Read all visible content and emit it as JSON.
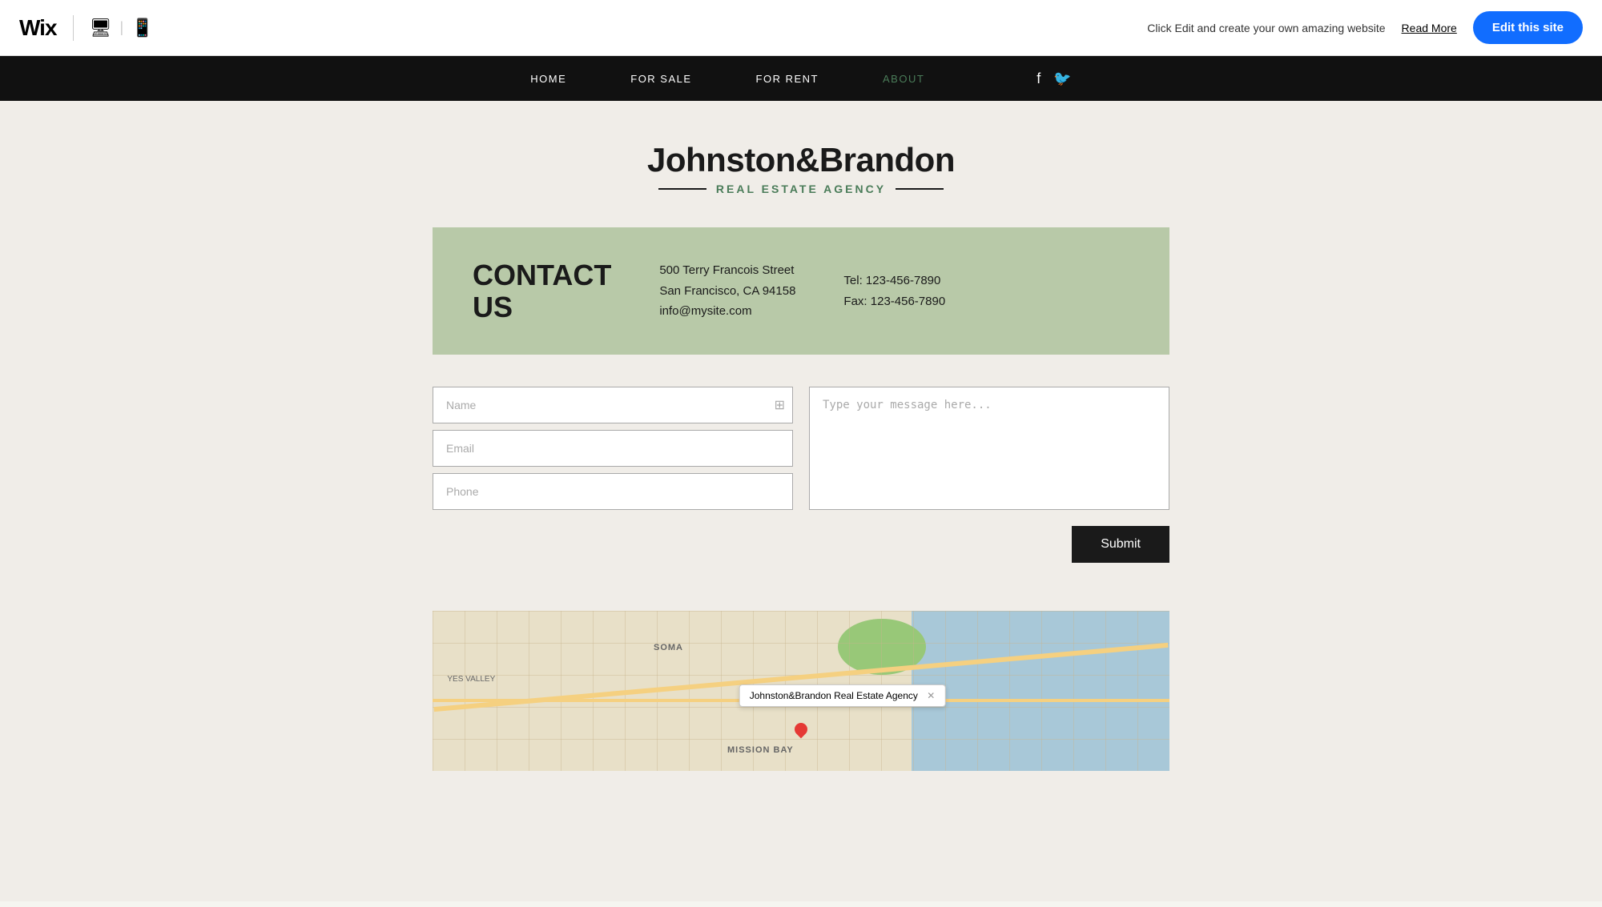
{
  "topbar": {
    "logo": "Wix",
    "message": "Click Edit and create your own amazing website",
    "read_more": "Read More",
    "edit_btn": "Edit this site"
  },
  "nav": {
    "items": [
      {
        "label": "HOME",
        "active": false
      },
      {
        "label": "FOR SALE",
        "active": false
      },
      {
        "label": "FOR RENT",
        "active": false
      },
      {
        "label": "ABOUT",
        "active": true
      }
    ]
  },
  "brand": {
    "name": "Johnston&Brandon",
    "subtitle": "Real Estate Agency"
  },
  "contact": {
    "title_line1": "CONTACT",
    "title_line2": "US",
    "address_line1": "500 Terry Francois Street",
    "address_line2": "San Francisco, CA  94158",
    "email": "info@mysite.com",
    "tel": "Tel: 123-456-7890",
    "fax": "Fax: 123-456-7890"
  },
  "form": {
    "name_placeholder": "Name",
    "email_placeholder": "Email",
    "phone_placeholder": "Phone",
    "message_placeholder": "Type your message here...",
    "submit_label": "Submit"
  },
  "map": {
    "tooltip_label": "Johnston&Brandon Real Estate Agency",
    "label_soma": "SOMA",
    "label_mission": "MISSION BAY",
    "label_yes_valley": "YES VALLEY"
  }
}
